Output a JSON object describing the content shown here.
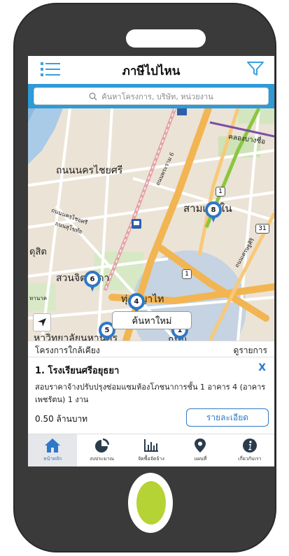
{
  "header": {
    "title": "ภาษีไปไหน"
  },
  "search": {
    "placeholder": "ค้นหาโครงการ, บริษัท, หน่วยงาน"
  },
  "map": {
    "labels": [
      "ถนนนครไชยศรี",
      "สามเสนใน",
      "ดุสิต",
      "สวนจิตรลดา",
      "ทุ่งพญาไท",
      "ถนนนครไชยศรี",
      "ถนนสุโขทัย",
      "คลองบางซื่อ",
      "ถนนพระราม 6",
      "ถนนเศรษฐศิริ",
      "หาวิทยาลัยนหานคร",
      "หานาค",
      "ถนน"
    ],
    "markers": [
      "6",
      "8",
      "4",
      "5",
      "1"
    ],
    "road_badges": [
      "1",
      "31",
      "1"
    ],
    "new_search_label": "ค้นหาใหม่"
  },
  "nearby": {
    "title": "โครงการใกล้เคียง",
    "view_list": "ดูรายการ"
  },
  "card": {
    "name": "1. โรงเรียนศรีอยุธยา",
    "close": "X",
    "description": "สอบราคาจ้างปรับปรุงซ่อมแซมห้องโภชนาการชั้น 1 อาคาร 4 (อาคารเพชรัตน) 1 งาน",
    "budget": "0.50 ล้านบาท",
    "detail_button": "รายละเอียด"
  },
  "bottom_nav": {
    "items": [
      {
        "label": "หน้าหลัก",
        "icon": "home-icon",
        "active": true
      },
      {
        "label": "งบประมาณ",
        "icon": "pie-chart-icon",
        "active": false
      },
      {
        "label": "จัดซื้อจัดจ้าง",
        "icon": "bar-chart-icon",
        "active": false
      },
      {
        "label": "แผนที่",
        "icon": "map-pin-icon",
        "active": false
      },
      {
        "label": "เกี่ยวกับเรา",
        "icon": "info-icon",
        "active": false
      }
    ]
  },
  "colors": {
    "primary": "#2e78c7",
    "search_bar": "#2e9ad6",
    "phone_body": "#3a3a3a",
    "home_button": "#b5d334"
  }
}
